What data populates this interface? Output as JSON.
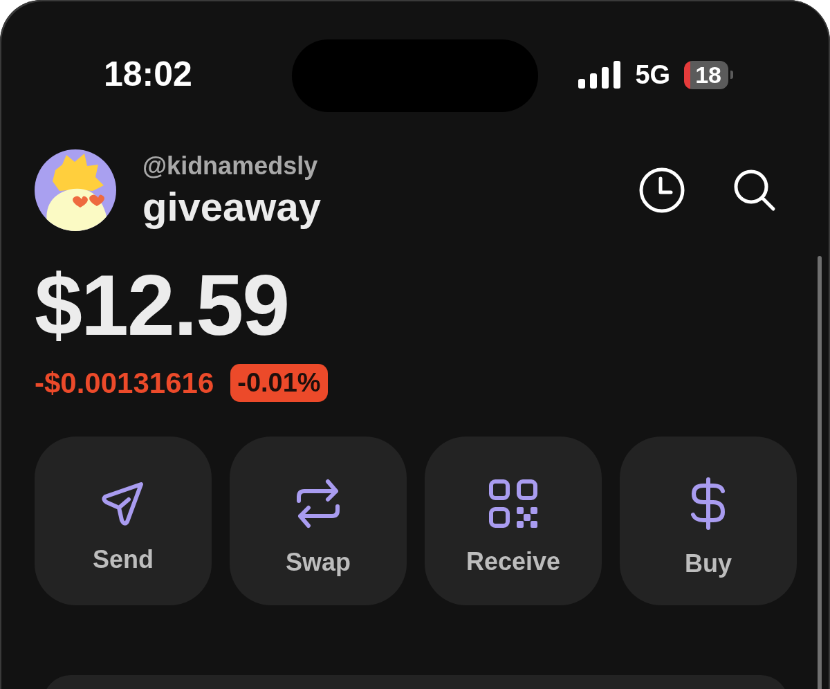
{
  "status_bar": {
    "time": "18:02",
    "network": "5G",
    "battery": "18"
  },
  "profile": {
    "handle": "@kidnamedsly",
    "name": "giveaway"
  },
  "balance": {
    "amount": "$12.59",
    "change": "-$0.00131616",
    "change_percent": "-0.01%"
  },
  "actions": [
    {
      "kind": "send",
      "label": "Send"
    },
    {
      "kind": "swap",
      "label": "Swap"
    },
    {
      "kind": "receive",
      "label": "Receive"
    },
    {
      "kind": "buy",
      "label": "Buy"
    }
  ]
}
